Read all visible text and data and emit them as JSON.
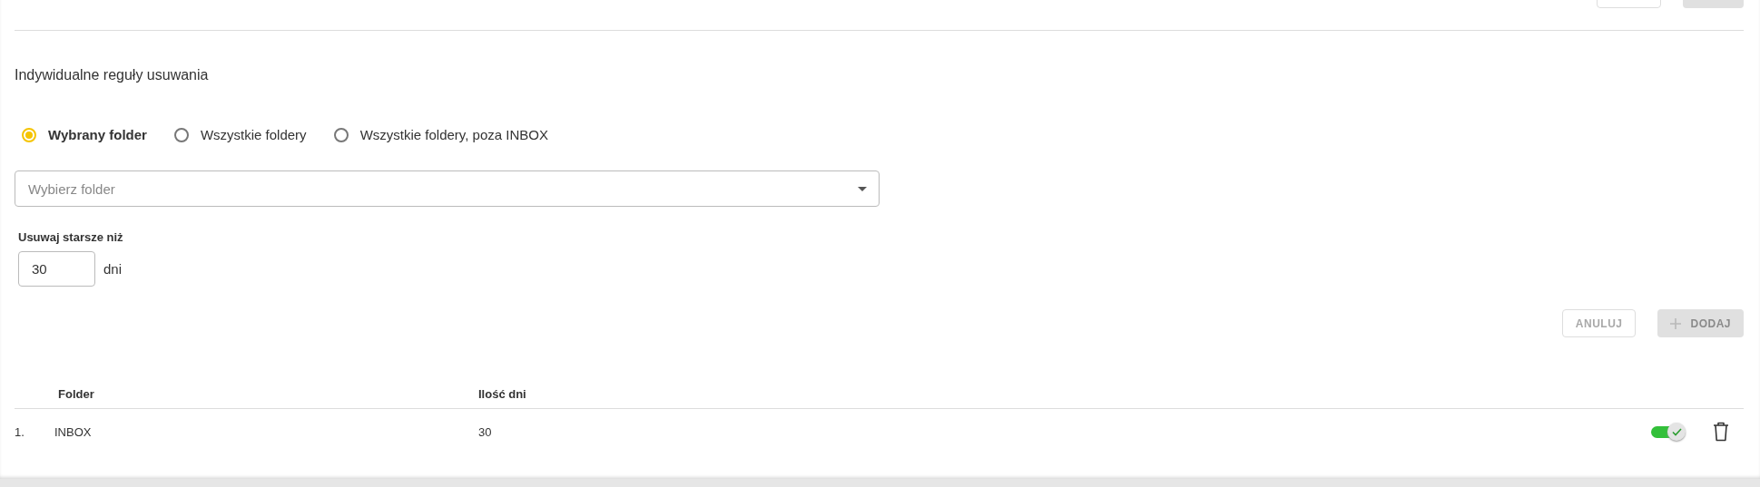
{
  "top_buttons": [
    {
      "kind": "outlined"
    },
    {
      "kind": "filled"
    }
  ],
  "section": {
    "title": "Indywidualne reguły usuwania"
  },
  "scope_options": [
    {
      "label": "Wybrany folder",
      "selected": true
    },
    {
      "label": "Wszystkie foldery",
      "selected": false
    },
    {
      "label": "Wszystkie foldery, poza INBOX",
      "selected": false
    }
  ],
  "folder_select": {
    "placeholder": "Wybierz folder"
  },
  "days": {
    "label": "Usuwaj starsze niż",
    "value": "30",
    "unit": "dni"
  },
  "actions": [
    {
      "label": "ANULUJ",
      "kind": "outlined",
      "disabled": true
    },
    {
      "label": "DODAJ",
      "kind": "add",
      "disabled": true
    }
  ],
  "table": {
    "columns": [
      "Folder",
      "Ilość dni"
    ],
    "rows": [
      {
        "number": "1.",
        "folder": "INBOX",
        "days": "30",
        "on": true
      }
    ]
  }
}
